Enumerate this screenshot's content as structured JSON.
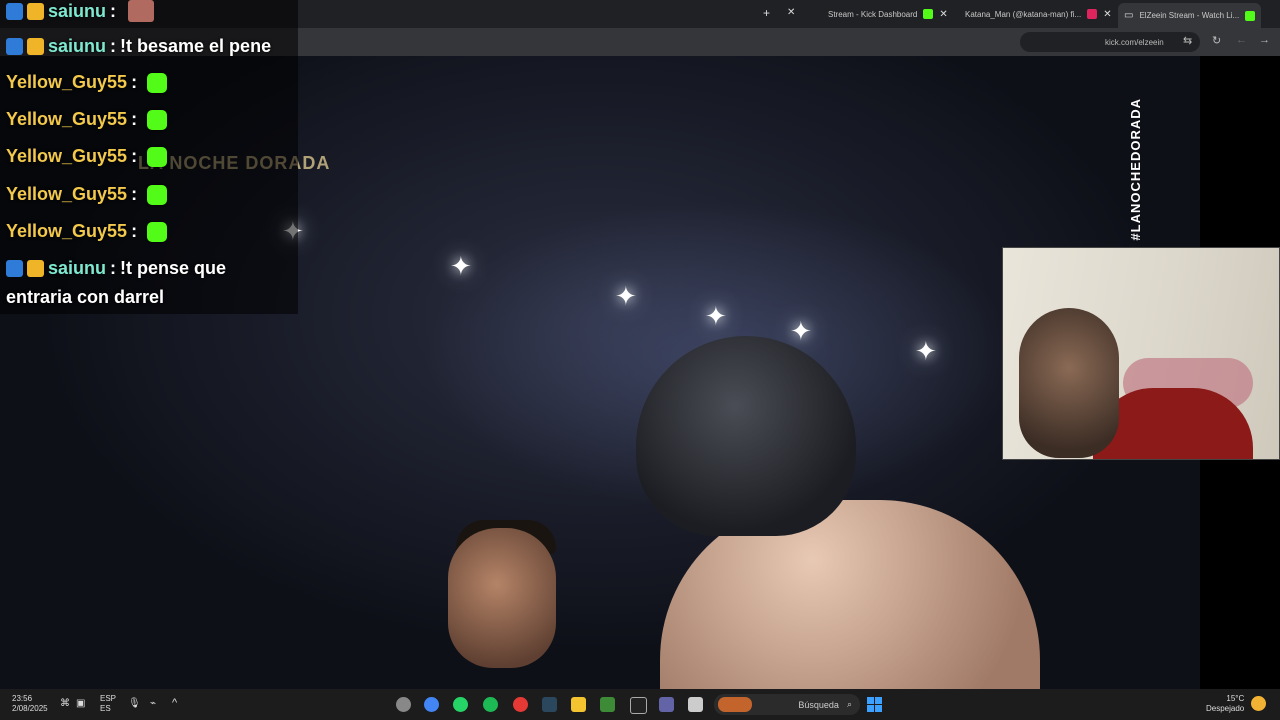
{
  "browser": {
    "tabs": [
      {
        "label": "ElZeein Stream - Watch Li...",
        "favicon_color": "#53fc18"
      },
      {
        "label": "Katana_Man (@katana-man) fi...",
        "favicon_color": "#e0245e"
      },
      {
        "label": "Stream - Kick Dashboard",
        "favicon_color": "#53fc18"
      }
    ],
    "new_tab": "+",
    "address": "kick.com/elzeein"
  },
  "video": {
    "hashtag": "#LANOCHEDORADA",
    "logo": "LA NOCHE DORADA"
  },
  "chat": {
    "messages": [
      {
        "user": "saiunu",
        "text": ""
      },
      {
        "user": "saiunu",
        "text": "!t besame el pene"
      },
      {
        "user": "Yellow_Guy55",
        "text": ""
      },
      {
        "user": "Yellow_Guy55",
        "text": ""
      },
      {
        "user": "Yellow_Guy55",
        "text": ""
      },
      {
        "user": "Yellow_Guy55",
        "text": ""
      },
      {
        "user": "Yellow_Guy55",
        "text": ""
      },
      {
        "user": "saiunu",
        "text": "!t pense que"
      }
    ],
    "wrap_text": "entraria con darrel",
    "separator": ":",
    "colors": {
      "teal": "#7fe8d0",
      "yellow": "#f2c94c",
      "emote": "#53fc18"
    }
  },
  "taskbar": {
    "weather_temp": "15°C",
    "weather_desc": "Despejado",
    "search_label": "Búsqueda",
    "time": "23:56",
    "date": "2/08/2025",
    "lang_top": "ESP",
    "lang_bottom": "ES"
  }
}
